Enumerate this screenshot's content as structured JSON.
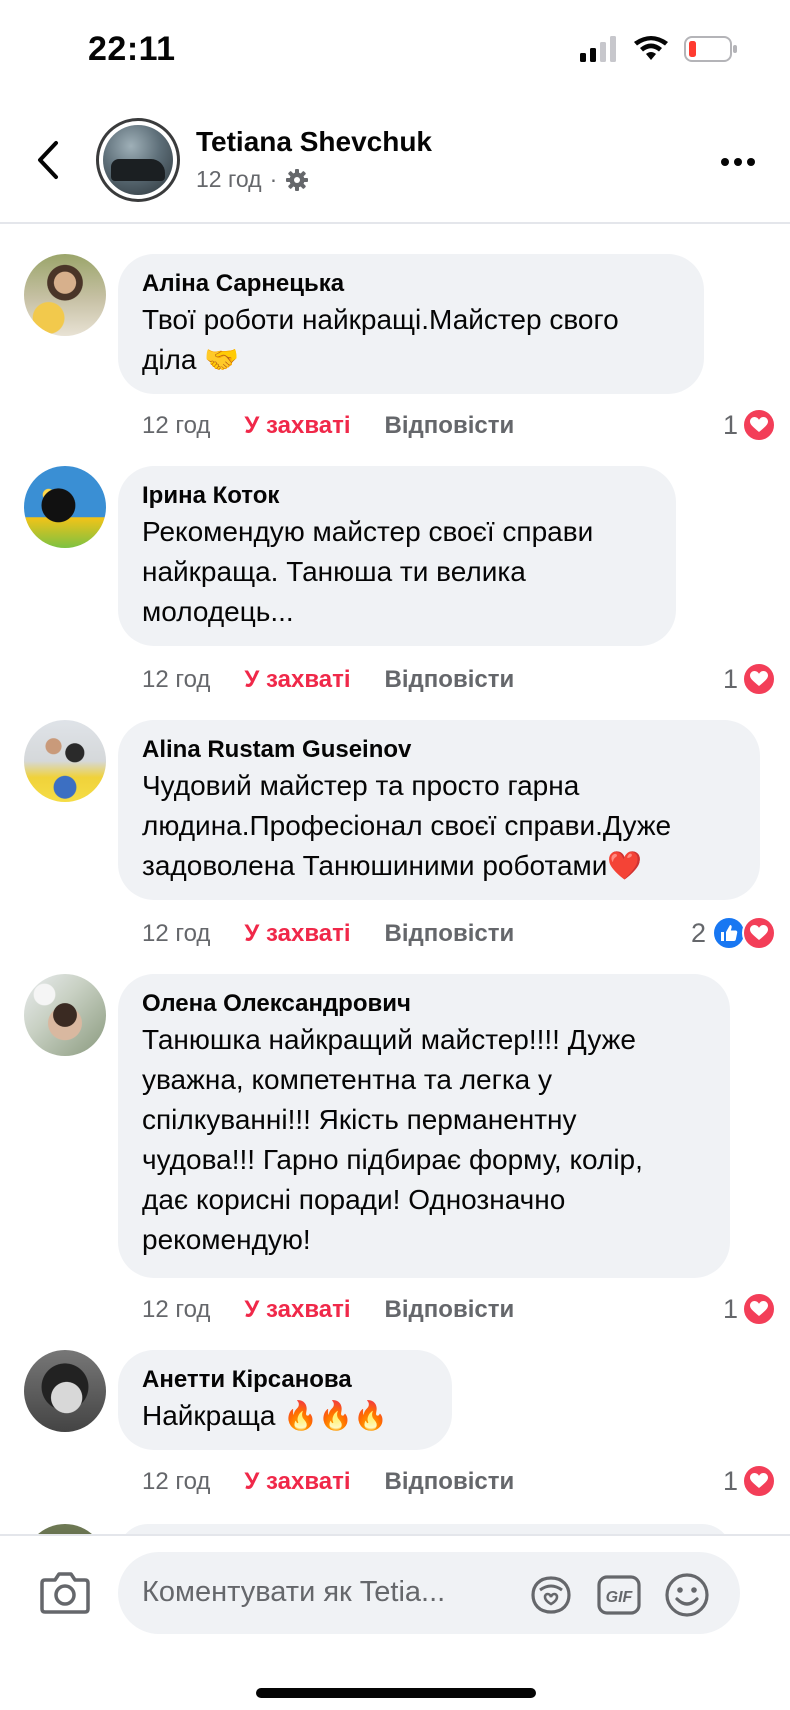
{
  "status_bar": {
    "time": "22:11"
  },
  "header": {
    "name": "Tetiana Shevchuk",
    "time": "12 год",
    "separator": "·"
  },
  "actions": {
    "love_label": "У захваті",
    "reply_label": "Відповісти"
  },
  "comments": [
    {
      "author": "Аліна Сарнецька",
      "lines": [
        "Твої роботи найкращі.Майстер свого",
        "діла 🤝"
      ],
      "time": "12 год",
      "reactions": {
        "count": "1",
        "types": [
          "love"
        ]
      }
    },
    {
      "author": "Ірина Коток",
      "lines": [
        "Рекомендую майстер своєї справи",
        "найкраща. Танюша ти велика",
        "молодець..."
      ],
      "time": "12 год",
      "reactions": {
        "count": "1",
        "types": [
          "love"
        ]
      }
    },
    {
      "author": "Alina Rustam Guseinov",
      "lines": [
        "Чудовий майстер та просто гарна",
        "людина.Професіонал своєї справи.Дуже",
        "задоволена Танюшиними роботами❤️"
      ],
      "time": "12 год",
      "reactions": {
        "count": "2",
        "types": [
          "like",
          "love"
        ]
      }
    },
    {
      "author": "Олена Олександрович",
      "lines": [
        "Танюшка найкращий майстер!!!! Дуже",
        "уважна, компетентна та легка у",
        "спілкуванні!!! Якість перманентну",
        "чудова!!! Гарно підбирає форму, колір,",
        "дає корисні поради! Однозначно",
        "рекомендую!"
      ],
      "time": "12 год",
      "reactions": {
        "count": "1",
        "types": [
          "love"
        ]
      }
    },
    {
      "author": "Анетти Кірсанова",
      "lines": [
        "Найкраща 🔥🔥🔥"
      ],
      "time": "12 год",
      "reactions": {
        "count": "1",
        "types": [
          "love"
        ]
      }
    }
  ],
  "composer": {
    "placeholder": "Коментувати як Tetia..."
  },
  "colors": {
    "love": "#f02849",
    "like": "#1877f2",
    "bubble": "#f0f2f5",
    "muted": "#65676b"
  }
}
